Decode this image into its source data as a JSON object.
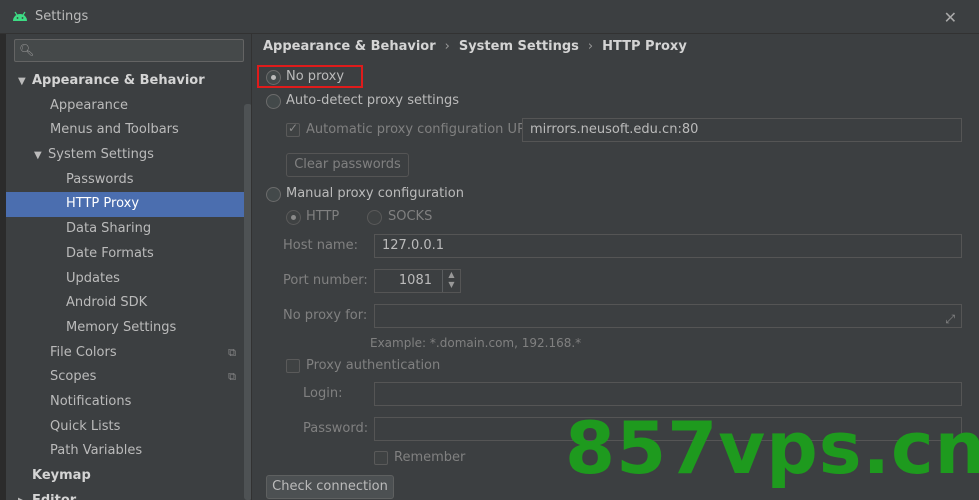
{
  "window": {
    "title": "Settings",
    "close_glyph": "✕"
  },
  "sidebar": {
    "search_placeholder": "",
    "items": [
      {
        "label": "Appearance & Behavior",
        "level": 0,
        "expanded": true,
        "bold": true
      },
      {
        "label": "Appearance",
        "level": 1
      },
      {
        "label": "Menus and Toolbars",
        "level": 1
      },
      {
        "label": "System Settings",
        "level": 1,
        "expanded": true
      },
      {
        "label": "Passwords",
        "level": 2
      },
      {
        "label": "HTTP Proxy",
        "level": 2,
        "selected": true
      },
      {
        "label": "Data Sharing",
        "level": 2
      },
      {
        "label": "Date Formats",
        "level": 2
      },
      {
        "label": "Updates",
        "level": 2
      },
      {
        "label": "Android SDK",
        "level": 2
      },
      {
        "label": "Memory Settings",
        "level": 2
      },
      {
        "label": "File Colors",
        "level": 1,
        "copy_icon": true
      },
      {
        "label": "Scopes",
        "level": 1,
        "copy_icon": true
      },
      {
        "label": "Notifications",
        "level": 1
      },
      {
        "label": "Quick Lists",
        "level": 1
      },
      {
        "label": "Path Variables",
        "level": 1
      },
      {
        "label": "Keymap",
        "level": 0,
        "bold": true
      },
      {
        "label": "Editor",
        "level": 0,
        "bold": true,
        "collapsed": true
      }
    ]
  },
  "breadcrumb": [
    "Appearance & Behavior",
    "System Settings",
    "HTTP Proxy"
  ],
  "proxy": {
    "no_proxy_label": "No proxy",
    "auto_detect_label": "Auto-detect proxy settings",
    "auto_config_url_label": "Automatic proxy configuration URL:",
    "auto_config_url_value": "mirrors.neusoft.edu.cn:80",
    "clear_passwords_label": "Clear passwords",
    "manual_label": "Manual proxy configuration",
    "http_label": "HTTP",
    "socks_label": "SOCKS",
    "host_name_label": "Host name:",
    "host_name_value": "127.0.0.1",
    "port_number_label": "Port number:",
    "port_number_value": "1081",
    "no_proxy_for_label": "No proxy for:",
    "no_proxy_for_value": "",
    "example_text": "Example: *.domain.com, 192.168.*",
    "proxy_auth_label": "Proxy authentication",
    "login_label": "Login:",
    "login_value": "",
    "password_label": "Password:",
    "password_value": "",
    "remember_label": "Remember",
    "check_connection_label": "Check connection"
  },
  "watermark": "857vps.cn",
  "colors": {
    "accent_selected": "#4b6eaf",
    "highlight_box": "#e01b1b",
    "watermark": "#1e9a1e"
  }
}
